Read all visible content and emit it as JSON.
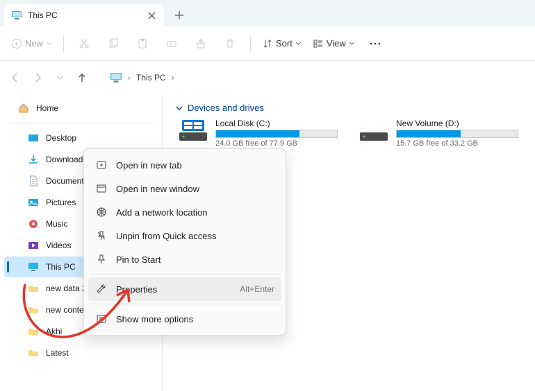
{
  "tab": {
    "title": "This PC"
  },
  "toolbar": {
    "new_label": "New",
    "sort_label": "Sort",
    "view_label": "View"
  },
  "breadcrumb": {
    "item": "This PC"
  },
  "sidebar": {
    "home_label": "Home",
    "items": [
      {
        "label": "Desktop"
      },
      {
        "label": "Downloads"
      },
      {
        "label": "Documents"
      },
      {
        "label": "Pictures"
      },
      {
        "label": "Music"
      },
      {
        "label": "Videos"
      },
      {
        "label": "This PC"
      },
      {
        "label": "new data 23"
      },
      {
        "label": "new content 1-11-23"
      },
      {
        "label": "Akhi"
      },
      {
        "label": "Latest"
      }
    ]
  },
  "main": {
    "group_label": "Devices and drives",
    "drives": [
      {
        "name": "Local Disk (C:)",
        "free": "24.0 GB free of 77.9 GB",
        "fill_pct": 69
      },
      {
        "name": "New Volume (D:)",
        "free": "15.7 GB free of 33.2 GB",
        "fill_pct": 53
      }
    ]
  },
  "ctx": {
    "items": [
      {
        "label": "Open in new tab"
      },
      {
        "label": "Open in new window"
      },
      {
        "label": "Add a network location"
      },
      {
        "label": "Unpin from Quick access"
      },
      {
        "label": "Pin to Start"
      },
      {
        "label": "Properties",
        "accel": "Alt+Enter"
      },
      {
        "label": "Show more options"
      }
    ]
  }
}
